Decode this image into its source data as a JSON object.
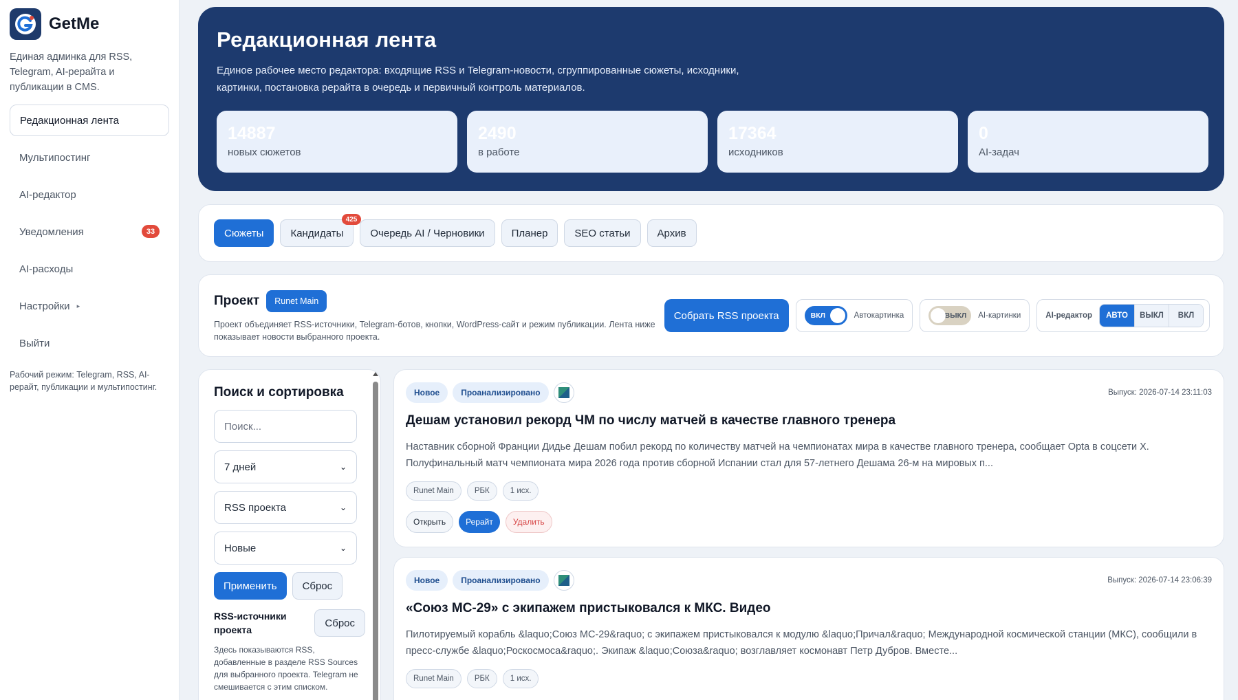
{
  "brand": {
    "name": "GetMe",
    "description": "Единая админка для RSS, Telegram, AI-рерайта и публикации в CMS."
  },
  "sidebar": {
    "items": [
      {
        "label": "Редакционная лента",
        "active": true
      },
      {
        "label": "Мультипостинг"
      },
      {
        "label": "AI-редактор"
      },
      {
        "label": "Уведомления",
        "badge": "33"
      },
      {
        "label": "AI-расходы"
      },
      {
        "label": "Настройки",
        "caret": "▸"
      },
      {
        "label": "Выйти"
      }
    ],
    "work_mode": "Рабочий режим: Telegram, RSS, AI-рерайт, публикации и мультипостинг."
  },
  "hero": {
    "title": "Редакционная лента",
    "description": "Единое рабочее место редактора: входящие RSS и Telegram-новости, сгруппированные сюжеты, исходники, картинки, постановка рерайта в очередь и первичный контроль материалов.",
    "stats": [
      {
        "value": "14887",
        "label": "новых сюжетов"
      },
      {
        "value": "2490",
        "label": "в работе"
      },
      {
        "value": "17364",
        "label": "исходников"
      },
      {
        "value": "0",
        "label": "AI-задач"
      }
    ]
  },
  "tabs": [
    {
      "label": "Сюжеты",
      "active": true
    },
    {
      "label": "Кандидаты",
      "badge": "425"
    },
    {
      "label": "Очередь AI / Черновики"
    },
    {
      "label": "Планер"
    },
    {
      "label": "SEO статьи"
    },
    {
      "label": "Архив"
    }
  ],
  "project": {
    "label": "Проект",
    "name": "Runet Main",
    "description": "Проект объединяет RSS-источники, Telegram-ботов, кнопки, WordPress-сайт и режим публикации. Лента ниже показывает новости выбранного проекта.",
    "collect_button": "Собрать RSS проекта",
    "auto_image": {
      "state": "ВКЛ",
      "label": "Автокартинка"
    },
    "ai_images": {
      "state": "ВЫКЛ",
      "label": "AI-картинки"
    },
    "ai_editor": {
      "label": "AI-редактор",
      "options": [
        "АВТО",
        "ВЫКЛ",
        "ВКЛ"
      ],
      "selected": "АВТО"
    }
  },
  "filters": {
    "title": "Поиск и сортировка",
    "search_placeholder": "Поиск...",
    "period": "7 дней",
    "source": "RSS проекта",
    "status": "Новые",
    "apply": "Применить",
    "reset": "Сброс",
    "rss_title": "RSS-источники проекта",
    "rss_reset": "Сброс",
    "rss_desc": "Здесь показываются RSS, добавленные в разделе RSS Sources для выбранного проекта. Telegram не смешивается с этим списком."
  },
  "news": [
    {
      "tags": [
        "Новое",
        "Проанализировано"
      ],
      "release": "Выпуск: 2026-07-14 23:11:03",
      "title": "Дешам установил рекорд ЧМ по числу матчей в качестве главного тренера",
      "text": "Наставник сборной Франции Дидье Дешам побил рекорд по количеству матчей на чемпионатах мира в качестве главного тренера, сообщает Opta в соцсети X. Полуфинальный матч чемпионата мира 2026 года против сборной Испании стал для 57-летнего Дешама 26-м на мировых п...",
      "chips": [
        "Runet Main",
        "РБК",
        "1 исх."
      ],
      "actions": {
        "open": "Открыть",
        "rewrite": "Рерайт",
        "delete": "Удалить"
      }
    },
    {
      "tags": [
        "Новое",
        "Проанализировано"
      ],
      "release": "Выпуск: 2026-07-14 23:06:39",
      "title": "«Союз МС-29» с экипажем пристыковался к МКС. Видео",
      "text": "Пилотируемый корабль &laquo;Союз МС-29&raquo; с экипажем пристыковался к модулю &laquo;Причал&raquo; Международной космической станции (МКС), сообщили в пресс-службе &laquo;Роскосмоса&raquo;. Экипаж &laquo;Союза&raquo; возглавляет космонавт Петр Дубров. Вместе...",
      "chips": [
        "Runet Main",
        "РБК",
        "1 исх."
      ]
    }
  ],
  "colors": {
    "primary": "#1f6fd6",
    "hero": "#1d3a6e",
    "danger": "#e24a3b"
  }
}
